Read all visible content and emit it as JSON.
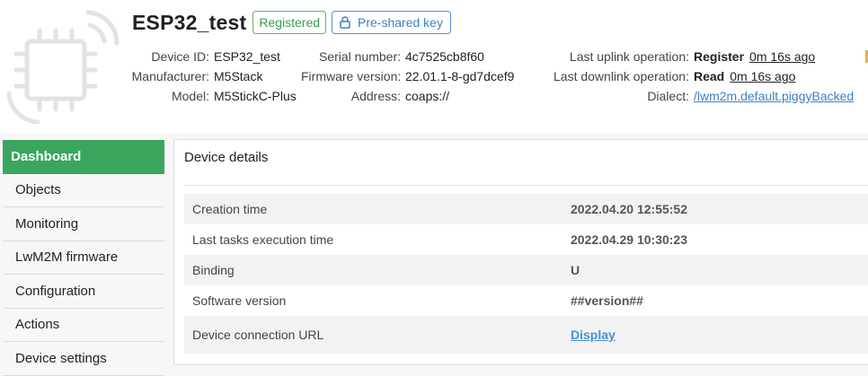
{
  "device": {
    "name": "ESP32_test",
    "status_badge": "Registered",
    "security_badge": "Pre-shared key",
    "icon": "chip-wireless-icon"
  },
  "meta": {
    "col1": [
      {
        "label": "Device ID:",
        "value": "ESP32_test"
      },
      {
        "label": "Manufacturer:",
        "value": "M5Stack"
      },
      {
        "label": "Model:",
        "value": "M5StickC-Plus"
      }
    ],
    "col2": [
      {
        "label": "Serial number:",
        "value": "4c7525cb8f60"
      },
      {
        "label": "Firmware version:",
        "value": "22.01.1-8-gd7dcef9"
      },
      {
        "label": "Address:",
        "value": "coaps://"
      }
    ],
    "col3": {
      "uplink": {
        "label": "Last uplink operation:",
        "operation": "Register",
        "ago": "0m 16s ago"
      },
      "downlink": {
        "label": "Last downlink operation:",
        "operation": "Read",
        "ago": "0m 16s ago"
      },
      "dialect": {
        "label": "Dialect:",
        "value": "/lwm2m.default.piggyBacked"
      }
    }
  },
  "sidebar": {
    "items": [
      {
        "label": "Dashboard",
        "active": true
      },
      {
        "label": "Objects"
      },
      {
        "label": "Monitoring"
      },
      {
        "label": "LwM2M firmware"
      },
      {
        "label": "Configuration"
      },
      {
        "label": "Actions"
      },
      {
        "label": "Device settings"
      }
    ]
  },
  "panel": {
    "title": "Device details",
    "rows": [
      {
        "label": "Creation time",
        "value": "2022.04.20 12:55:52"
      },
      {
        "label": "Last tasks execution time",
        "value": "2022.04.29 10:30:23"
      },
      {
        "label": "Binding",
        "value": "U"
      },
      {
        "label": "Software version",
        "value": "##version##"
      },
      {
        "label": "Device connection URL",
        "value": "Display"
      }
    ]
  },
  "colors": {
    "accent_green": "#3aa65d",
    "badge_green": "#5cb85c",
    "link_blue": "#4a90d9"
  }
}
